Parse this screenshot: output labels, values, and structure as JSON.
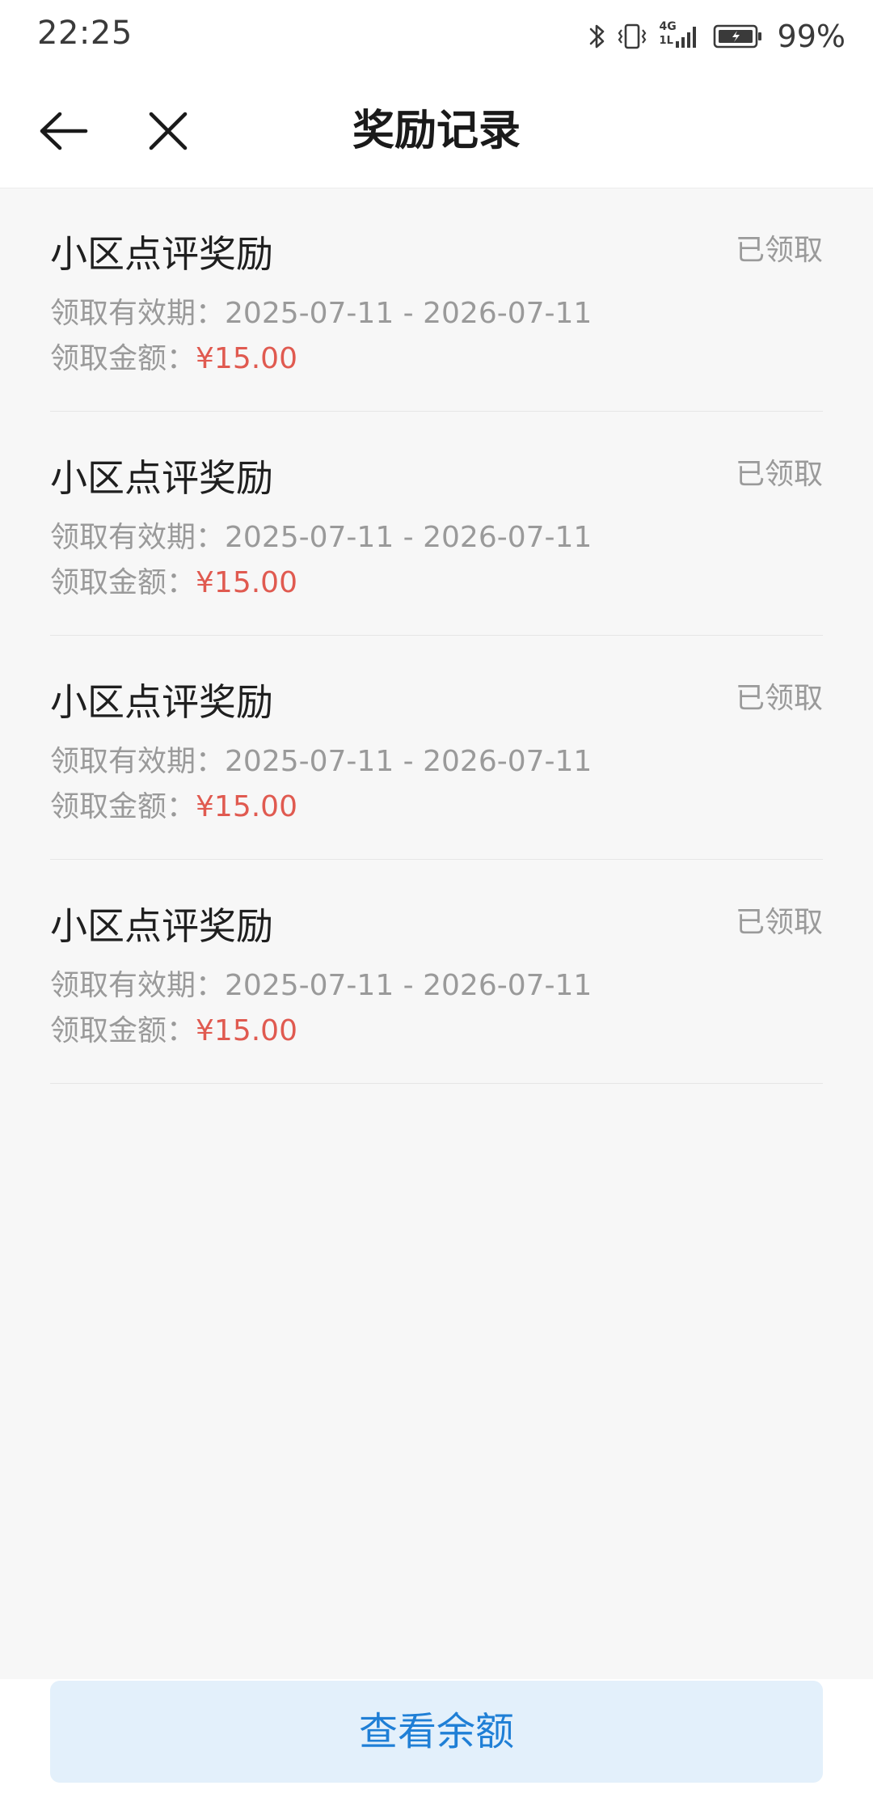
{
  "status_bar": {
    "time": "22:25",
    "battery_percent": "99%",
    "network_label_top": "4G",
    "network_label_bottom": "1L",
    "icons": [
      "bluetooth-icon",
      "vibrate-icon",
      "signal-icon",
      "battery-icon"
    ]
  },
  "header": {
    "title": "奖励记录",
    "back_icon": "arrow-left-icon",
    "close_icon": "close-icon"
  },
  "records": [
    {
      "title": "小区点评奖励",
      "status": "已领取",
      "period_label": "领取有效期：",
      "period_value": "2025-07-11 - 2026-07-11",
      "amount_label": "领取金额：",
      "amount_value": "¥15.00"
    },
    {
      "title": "小区点评奖励",
      "status": "已领取",
      "period_label": "领取有效期：",
      "period_value": "2025-07-11 - 2026-07-11",
      "amount_label": "领取金额：",
      "amount_value": "¥15.00"
    },
    {
      "title": "小区点评奖励",
      "status": "已领取",
      "period_label": "领取有效期：",
      "period_value": "2025-07-11 - 2026-07-11",
      "amount_label": "领取金额：",
      "amount_value": "¥15.00"
    },
    {
      "title": "小区点评奖励",
      "status": "已领取",
      "period_label": "领取有效期：",
      "period_value": "2025-07-11 - 2026-07-11",
      "amount_label": "领取金额：",
      "amount_value": "¥15.00"
    }
  ],
  "footer": {
    "balance_button_label": "查看余额"
  },
  "colors": {
    "accent_blue": "#1f7fd6",
    "button_bg": "#e3f0fb",
    "amount_red": "#e05a50",
    "page_bg": "#f7f7f7"
  }
}
